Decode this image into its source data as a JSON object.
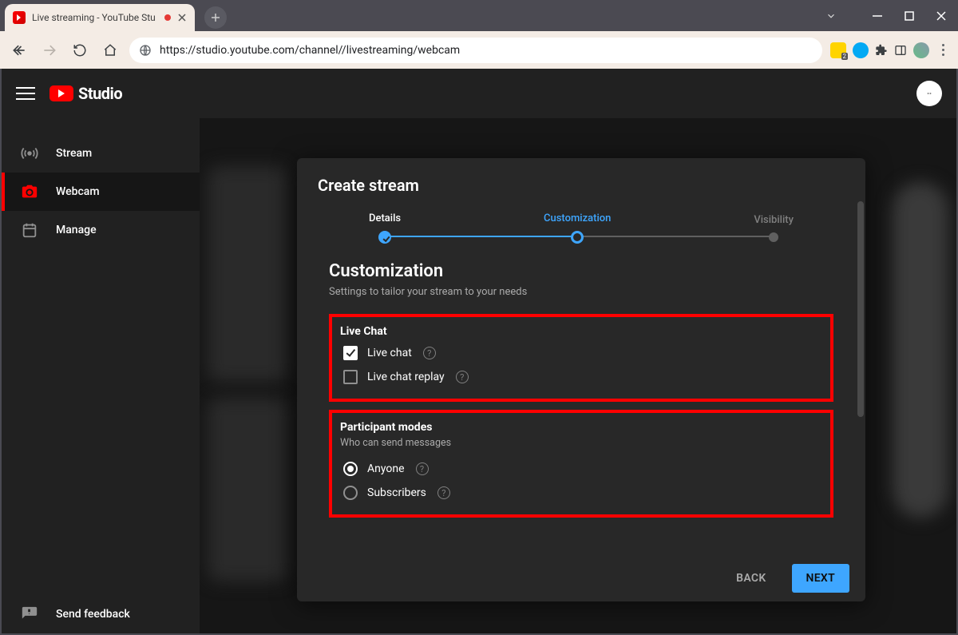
{
  "browser": {
    "tab_title": "Live streaming - YouTube Stu",
    "url": "https://studio.youtube.com/channel//livestreaming/webcam"
  },
  "app": {
    "brand": "Studio"
  },
  "sidebar": {
    "items": [
      {
        "label": "Stream"
      },
      {
        "label": "Webcam"
      },
      {
        "label": "Manage"
      }
    ],
    "feedback_label": "Send feedback"
  },
  "modal": {
    "title": "Create stream",
    "steps": {
      "details": "Details",
      "customization": "Customization",
      "visibility": "Visibility"
    },
    "section_title": "Customization",
    "section_subtitle": "Settings to tailor your stream to your needs",
    "live_chat": {
      "group_title": "Live Chat",
      "opt_live_chat": "Live chat",
      "opt_replay": "Live chat replay",
      "live_chat_checked": true,
      "replay_checked": false
    },
    "participants": {
      "group_title": "Participant modes",
      "group_sub": "Who can send messages",
      "opt_anyone": "Anyone",
      "opt_subscribers": "Subscribers",
      "selected": "anyone"
    },
    "buttons": {
      "back": "BACK",
      "next": "NEXT"
    }
  }
}
